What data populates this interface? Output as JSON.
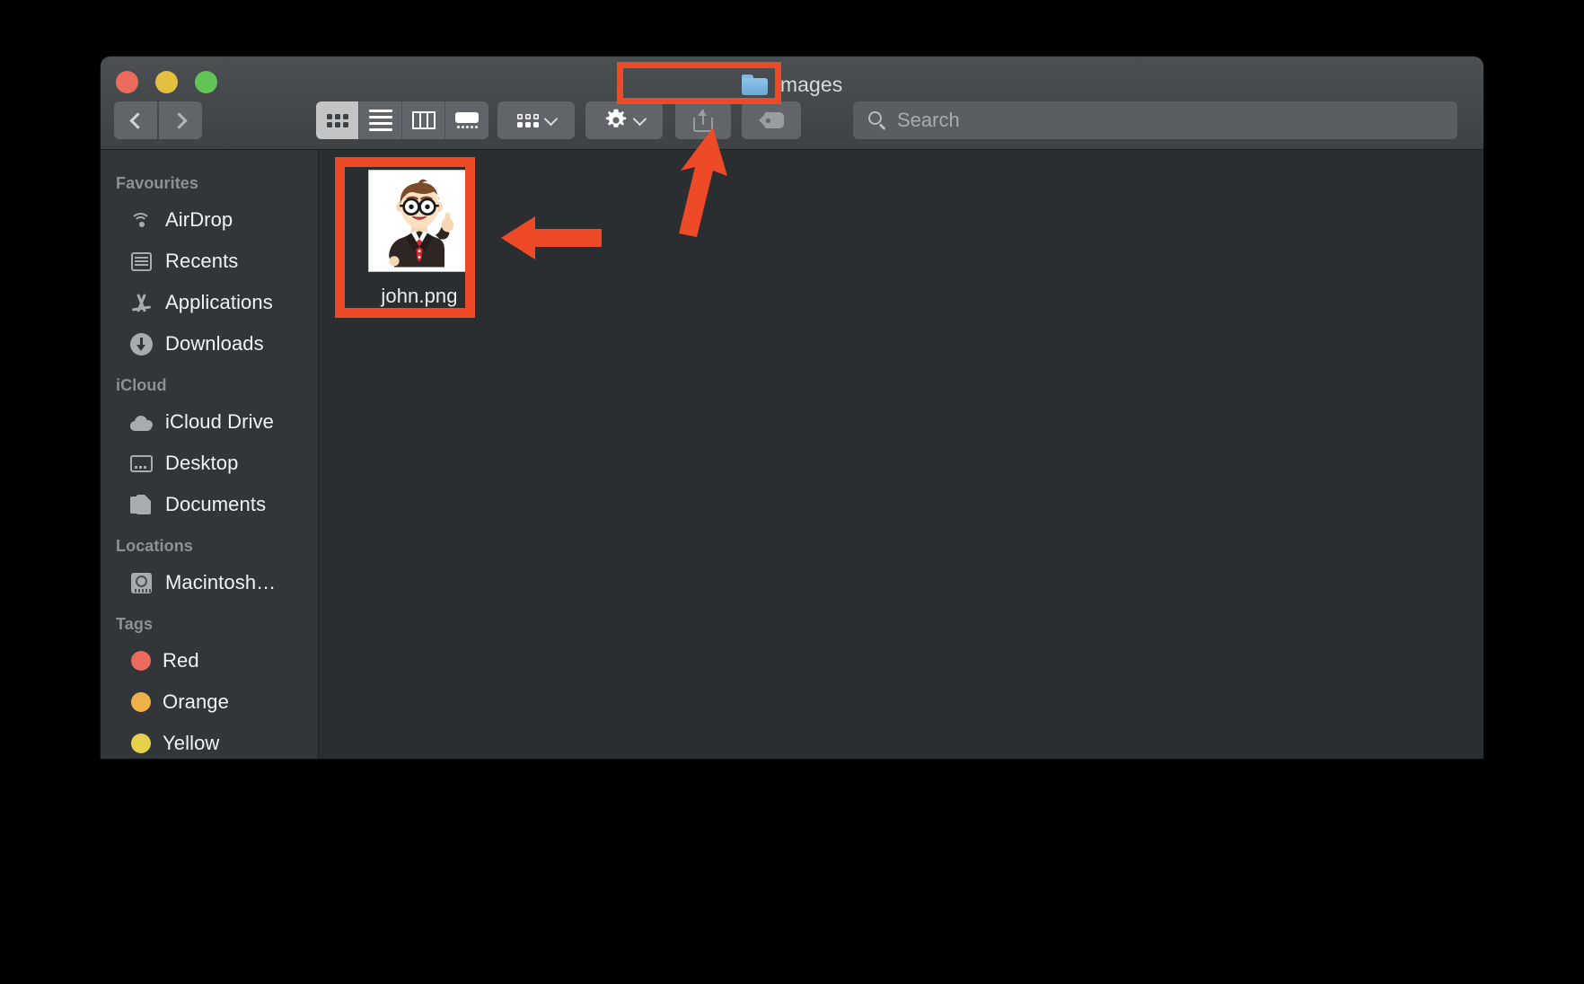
{
  "window": {
    "title": "images",
    "folder_icon": "folder-icon",
    "traffic_lights": [
      {
        "name": "close",
        "color": "#ec6b5e"
      },
      {
        "name": "minimize",
        "color": "#e4bf40"
      },
      {
        "name": "maximize",
        "color": "#61c454"
      }
    ]
  },
  "toolbar": {
    "back_icon": "chevron-left-icon",
    "forward_icon": "chevron-right-icon",
    "view_modes": [
      {
        "id": "icon",
        "icon": "grid-view-icon",
        "active": true
      },
      {
        "id": "list",
        "icon": "list-view-icon",
        "active": false
      },
      {
        "id": "column",
        "icon": "column-view-icon",
        "active": false
      },
      {
        "id": "gallery",
        "icon": "gallery-view-icon",
        "active": false
      }
    ],
    "group_button": {
      "icon": "group-by-icon",
      "caret": "chevron-down-icon"
    },
    "action_button": {
      "icon": "gear-icon",
      "caret": "chevron-down-icon"
    },
    "share_button": {
      "icon": "share-icon"
    },
    "tag_button": {
      "icon": "tag-icon"
    }
  },
  "search": {
    "icon": "search-icon",
    "placeholder": "Search",
    "value": ""
  },
  "sidebar": {
    "sections": [
      {
        "header": "Favourites",
        "items": [
          {
            "label": "AirDrop",
            "icon": "airdrop-icon"
          },
          {
            "label": "Recents",
            "icon": "recents-icon"
          },
          {
            "label": "Applications",
            "icon": "applications-icon"
          },
          {
            "label": "Downloads",
            "icon": "downloads-icon"
          }
        ]
      },
      {
        "header": "iCloud",
        "items": [
          {
            "label": "iCloud Drive",
            "icon": "icloud-drive-icon"
          },
          {
            "label": "Desktop",
            "icon": "desktop-icon"
          },
          {
            "label": "Documents",
            "icon": "documents-icon"
          }
        ]
      },
      {
        "header": "Locations",
        "items": [
          {
            "label": "Macintosh…",
            "icon": "hard-disk-icon"
          }
        ]
      },
      {
        "header": "Tags",
        "items": [
          {
            "label": "Red",
            "icon": "tag-dot",
            "color": "#ec6b5e"
          },
          {
            "label": "Orange",
            "icon": "tag-dot",
            "color": "#efb14a"
          },
          {
            "label": "Yellow",
            "icon": "tag-dot",
            "color": "#e8d14a"
          }
        ]
      }
    ]
  },
  "content": {
    "files": [
      {
        "name": "john.png",
        "thumbnail": "cartoon-man-avatar",
        "selected": true
      }
    ]
  },
  "annotations": {
    "accent_color": "#ef4a28",
    "title_highlight": "images",
    "file_highlight": "john.png",
    "arrow_left_target": "john.png",
    "arrow_up_target": "share-button"
  }
}
